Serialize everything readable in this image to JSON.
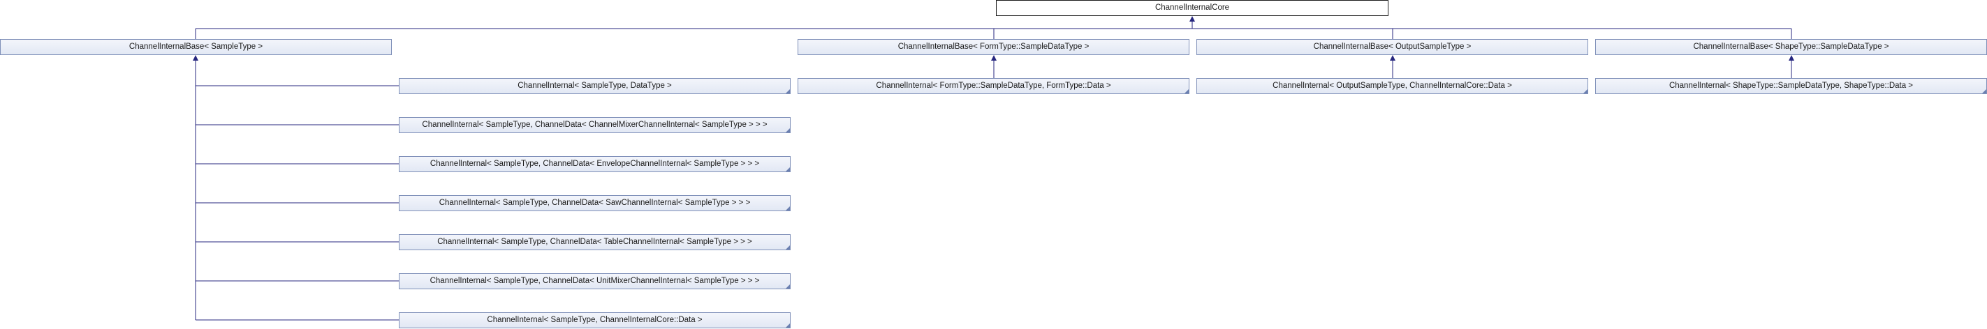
{
  "diagram": {
    "root": "ChannelInternalCore",
    "bases": [
      "ChannelInternalBase< SampleType >",
      "ChannelInternalBase< FormType::SampleDataType >",
      "ChannelInternalBase< OutputSampleType >",
      "ChannelInternalBase< ShapeType::SampleDataType >"
    ],
    "sample_type_children": [
      "ChannelInternal< SampleType, DataType >",
      "ChannelInternal< SampleType, ChannelData< ChannelMixerChannelInternal< SampleType > > >",
      "ChannelInternal< SampleType, ChannelData< EnvelopeChannelInternal< SampleType > > >",
      "ChannelInternal< SampleType, ChannelData< SawChannelInternal< SampleType > > >",
      "ChannelInternal< SampleType, ChannelData< TableChannelInternal< SampleType > > >",
      "ChannelInternal< SampleType, ChannelData< UnitMixerChannelInternal< SampleType > > >",
      "ChannelInternal< SampleType, ChannelInternalCore::Data >"
    ],
    "other_children": [
      "ChannelInternal< FormType::SampleDataType, FormType::Data >",
      "ChannelInternal< OutputSampleType, ChannelInternalCore::Data >",
      "ChannelInternal< ShapeType::SampleDataType, ShapeType::Data >"
    ],
    "edge_color": "#27277f"
  }
}
